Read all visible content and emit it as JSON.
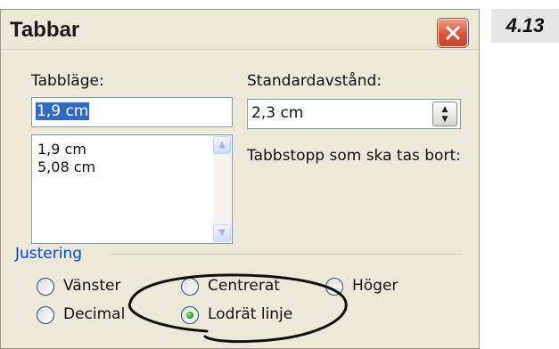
{
  "figure_number": "4.13",
  "dialog": {
    "title": "Tabbar",
    "close_icon": "close-x-icon"
  },
  "tab_position": {
    "label": "Tabbläge:",
    "value": "1,9 cm",
    "list": [
      "1,9 cm",
      "5,08 cm"
    ]
  },
  "default_spacing": {
    "label": "Standardavstånd:",
    "value": "2,3 cm",
    "spinner_icon": "up-down-spinner-icon"
  },
  "tabs_to_remove_label": "Tabbstopp som ska tas bort:",
  "alignment": {
    "group_label": "Justering",
    "options": [
      "Vänster",
      "Centrerat",
      "Höger",
      "Decimal",
      "Lodrät linje"
    ],
    "selected": "Lodrät linje"
  },
  "annotation": "hand-drawn circle around Lodrät linje"
}
